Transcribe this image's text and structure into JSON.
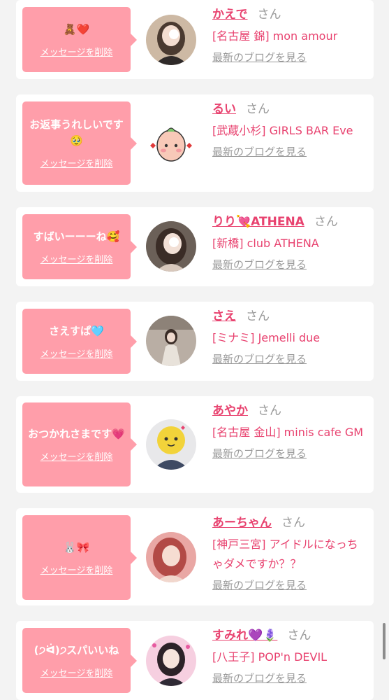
{
  "common": {
    "delete_label": "メッセージを削除",
    "honorific": "さん",
    "blog_label": "最新のブログを見る"
  },
  "messages": [
    {
      "text": "🧸❤️",
      "name": "かえで",
      "shop": "[名古屋 錦] mon amour"
    },
    {
      "text": "お返事うれしいです🥹",
      "name": "るい",
      "shop": "[武蔵小杉] GIRLS BAR Eve"
    },
    {
      "text": "すばいーーーね🥰",
      "name": "りり💘ATHENA",
      "shop": "[新橋] club ATHENA"
    },
    {
      "text": "さえすぱ🩵",
      "name": "さえ",
      "shop": "[ミナミ] Jemelli due"
    },
    {
      "text": "おつかれさまです💗",
      "name": "あやか",
      "shop": "[名古屋 金山] minis cafe GM"
    },
    {
      "text": "🐰🎀",
      "name": "あーちゃん",
      "shop": "[神戸三宮] アイドルになっちゃダメですか？？"
    },
    {
      "text": "(੭ᐛ)੭スパいいね",
      "name": "すみれ💜🪻",
      "shop": "[八王子] POP'n DEVIL"
    }
  ],
  "colors": {
    "bubble": "#ff9eaa",
    "name": "#e8426f",
    "muted": "#999999",
    "page_bg": "#f3f3f3"
  }
}
